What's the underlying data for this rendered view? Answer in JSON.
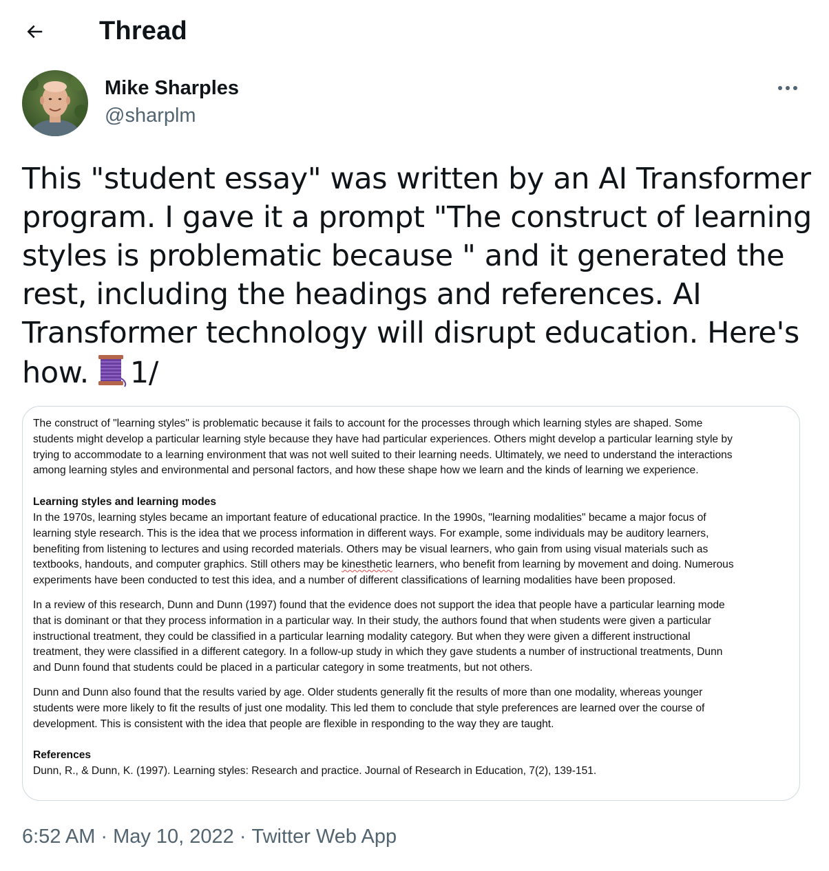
{
  "header": {
    "back_icon": "arrow-left-icon",
    "title": "Thread"
  },
  "author": {
    "name": "Mike Sharples",
    "handle": "@sharplm",
    "more_icon": "more-horizontal-icon"
  },
  "tweet": {
    "lines": [
      "This \"student essay\" was written by an AI Transformer",
      "program. I gave it a prompt \"The construct of learning",
      "styles is problematic because \" and it generated the",
      "rest, including the headings and references. AI",
      "Transformer technology will disrupt education. Here's"
    ],
    "last_prefix": "how.",
    "emoji_icon": "thread-spool-icon",
    "last_suffix": "1/"
  },
  "essay": {
    "intro_lines": [
      "The construct of \"learning styles\" is problematic because it fails to account for the processes through which learning styles are shaped. Some",
      "students might develop a particular learning style because they have had particular experiences. Others might develop a particular learning style by",
      "trying to accommodate to a learning environment that was not well suited to their learning needs. Ultimately, we need to understand the interactions",
      "among learning styles and environmental and personal factors, and how these shape how we learn and the kinds of learning we experience."
    ],
    "section_heading": "Learning styles and learning modes",
    "para1_lines_before": [
      "In the 1970s, learning styles became an important feature of educational practice. In the 1990s, \"learning modalities\" became a major focus of",
      "learning style research. This is the idea that we process information in different ways. For example, some individuals may be auditory learners,",
      "benefiting from listening to lectures and using recorded materials. Others may be visual learners, who gain from using visual materials such as"
    ],
    "para1_line4_prefix": "textbooks, handouts, and computer graphics. Still others may be ",
    "para1_line4_misspelled": "kinesthetic",
    "para1_line4_suffix": " learners, who benefit from learning by movement and doing. Numerous",
    "para1_line5": "experiments have been conducted to test this idea, and a number of different classifications of learning modalities have been proposed.",
    "para2_lines": [
      "In a review of this research, Dunn and Dunn (1997) found that the evidence does not support the idea that people have a particular learning mode",
      "that is dominant or that they process information in a particular way. In their study, the authors found that when students were given a particular",
      "instructional treatment, they could be classified in a particular learning modality category. But when they were given a different instructional",
      "treatment, they were classified in a different category. In a follow-up study in which they gave students a number of instructional treatments, Dunn",
      "and Dunn found that students could be placed in a particular category in some treatments, but not others."
    ],
    "para3_lines": [
      "Dunn and Dunn also found that the results varied by age. Older students generally fit the results of more than one modality, whereas younger",
      "students were more likely to fit the results of just one modality. This led them to conclude that style preferences are learned over the course of",
      "development. This is consistent with the idea that people are flexible in responding to the way they are taught."
    ],
    "references_heading": "References",
    "reference": "Dunn, R., & Dunn, K. (1997). Learning styles: Research and practice. Journal of Research in Education, 7(2), 139-151."
  },
  "footer": {
    "time": "6:52 AM",
    "separator": "·",
    "date": "May 10, 2022",
    "source": "Twitter Web App"
  },
  "colors": {
    "text": "#0f1419",
    "secondary": "#536471",
    "border": "#cfd9de",
    "spell_error": "#d9443f"
  }
}
